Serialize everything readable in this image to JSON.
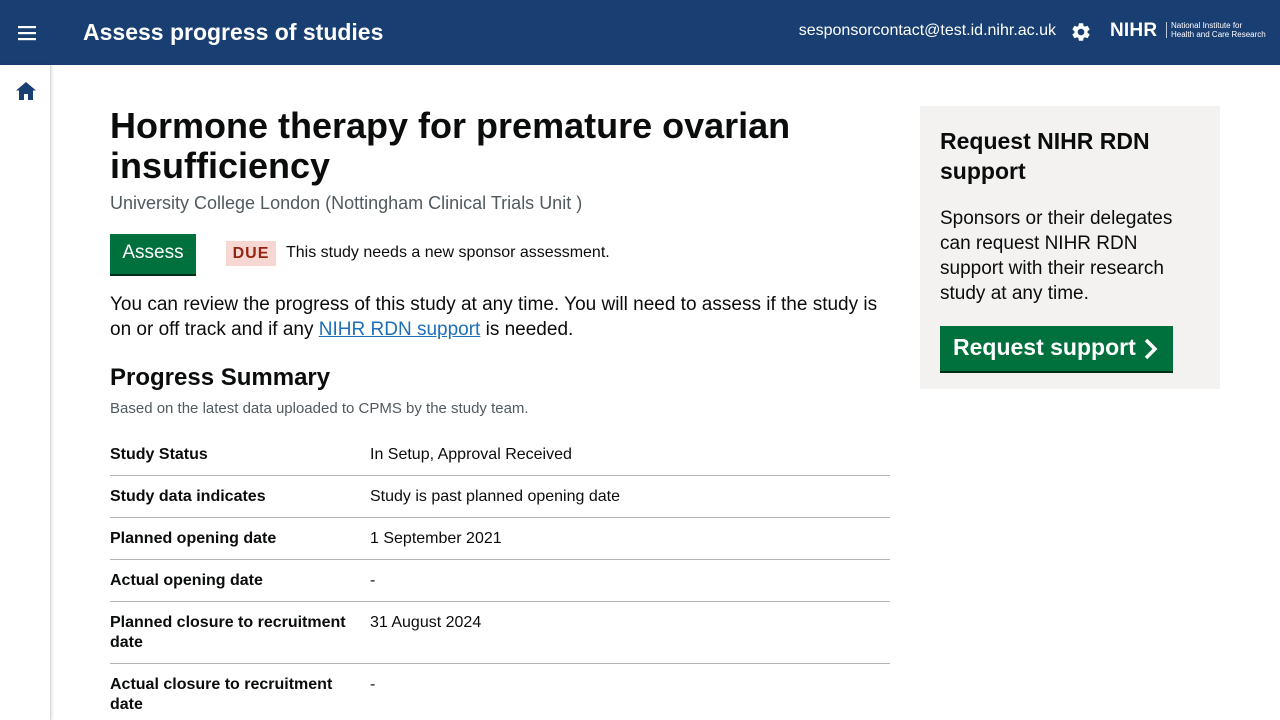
{
  "header": {
    "menu_icon": "menu-icon",
    "title": "Assess progress of studies",
    "user_email": "sesponsorcontact@test.id.nihr.ac.uk",
    "settings_icon": "gear-icon",
    "logo_text": "NIHR",
    "logo_subtext_line1": "National Institute for",
    "logo_subtext_line2": "Health and Care Research"
  },
  "sidenav": {
    "home_icon": "home-icon"
  },
  "study": {
    "title": "Hormone therapy for premature ovarian insufficiency",
    "organisation": "University College London (Nottingham Clinical Trials Unit )",
    "assess_label": "Assess",
    "due_tag": "DUE",
    "due_text": "This study needs a new sponsor assessment.",
    "intro_before": "You can review the progress of this study at any time. You will need to assess if the study is on or off track and if any ",
    "intro_link": "NIHR RDN support",
    "intro_after": " is needed."
  },
  "summary": {
    "title": "Progress Summary",
    "subtitle": "Based on the latest data uploaded to CPMS by the study team.",
    "rows": [
      {
        "label": "Study Status",
        "value": "In Setup, Approval Received"
      },
      {
        "label": "Study data indicates",
        "value": "Study is past planned opening date"
      },
      {
        "label": "Planned opening date",
        "value": "1 September 2021"
      },
      {
        "label": "Actual opening date",
        "value": "-"
      },
      {
        "label": "Planned closure to recruitment date",
        "value": "31 August 2024"
      },
      {
        "label": "Actual closure to recruitment date",
        "value": "-"
      }
    ]
  },
  "panel": {
    "title": "Request NIHR RDN support",
    "text": "Sponsors or their delegates can request NIHR RDN support with their research study at any time.",
    "button_label": "Request support",
    "button_icon": "chevron-right-icon"
  },
  "colors": {
    "header_bg": "#193e72",
    "primary_button": "#00703c",
    "link": "#1d70b8",
    "due_bg": "#f6d7d2",
    "due_text": "#942514",
    "panel_bg": "#f3f2f1"
  }
}
